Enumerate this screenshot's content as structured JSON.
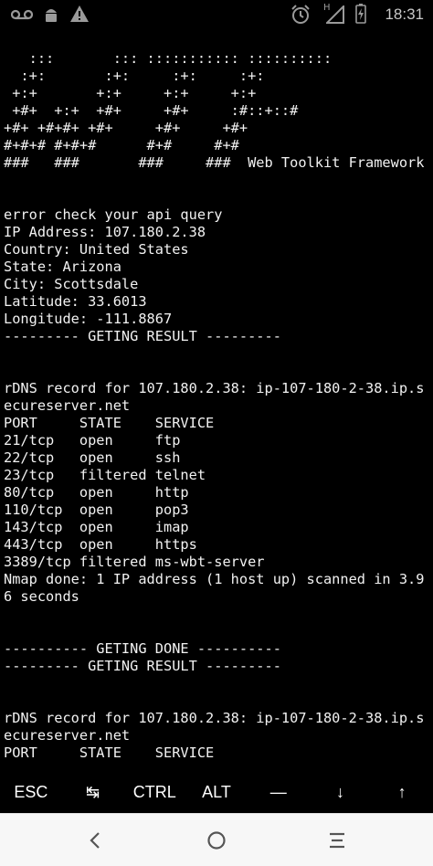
{
  "status_bar": {
    "time": "18:31",
    "network_type": "H",
    "icons": [
      "voicemail-icon",
      "android-icon",
      "warning-icon",
      "alarm-icon",
      "signal-icon",
      "battery-charging-icon"
    ]
  },
  "terminal": {
    "lines": [
      "   :::       ::: ::::::::::: :::::::::: ",
      "  :+:       :+:     :+:     :+:         ",
      " +:+       +:+     +:+     +:+          ",
      " +#+  +:+  +#+     +#+     :#::+::#     ",
      "+#+ +#+#+ +#+     +#+     +#+           ",
      "#+#+# #+#+#      #+#     #+#            ",
      "###   ###       ###     ###  Web Toolkit Framework",
      "",
      "",
      "error check your api query",
      "IP Address: 107.180.2.38",
      "Country: United States",
      "State: Arizona",
      "City: Scottsdale",
      "Latitude: 33.6013",
      "Longitude: -111.8867",
      "--------- GETING RESULT ---------",
      "",
      "",
      "rDNS record for 107.180.2.38: ip-107-180-2-38.ip.s",
      "ecureserver.net",
      "PORT     STATE    SERVICE",
      "21/tcp   open     ftp",
      "22/tcp   open     ssh",
      "23/tcp   filtered telnet",
      "80/tcp   open     http",
      "110/tcp  open     pop3",
      "143/tcp  open     imap",
      "443/tcp  open     https",
      "3389/tcp filtered ms-wbt-server",
      "Nmap done: 1 IP address (1 host up) scanned in 3.9",
      "6 seconds",
      "",
      "",
      "---------- GETING DONE ----------",
      "--------- GETING RESULT ---------",
      "",
      "",
      "rDNS record for 107.180.2.38: ip-107-180-2-38.ip.s",
      "ecureserver.net",
      "PORT     STATE    SERVICE"
    ]
  },
  "extra_keys": [
    {
      "name": "esc-key",
      "label": "ESC"
    },
    {
      "name": "tab-key",
      "label": "↹"
    },
    {
      "name": "ctrl-key",
      "label": "CTRL"
    },
    {
      "name": "alt-key",
      "label": "ALT"
    },
    {
      "name": "dash-key",
      "label": "—"
    },
    {
      "name": "arrow-down-key",
      "label": "↓"
    },
    {
      "name": "arrow-up-key",
      "label": "↑"
    }
  ],
  "nav_bar": {
    "icons": [
      "back-icon",
      "home-icon",
      "recents-icon"
    ]
  }
}
